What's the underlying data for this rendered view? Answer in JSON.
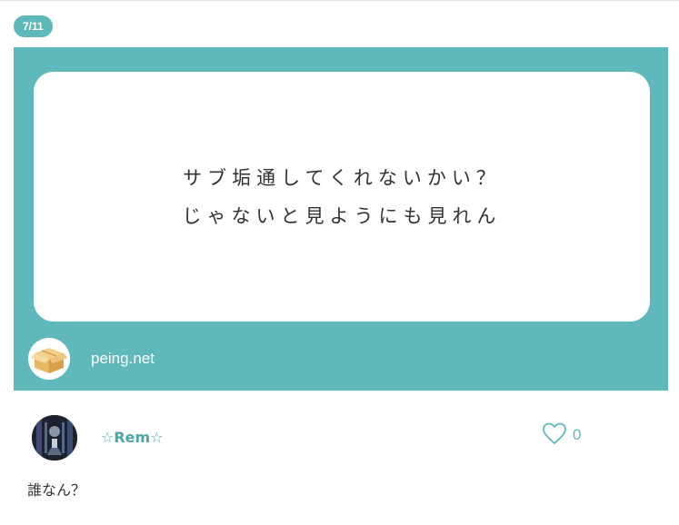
{
  "counter": {
    "label": "7/11"
  },
  "question": {
    "lines": [
      "サブ垢通してくれないかい？",
      "じゃないと見ようにも見れん"
    ]
  },
  "source": {
    "site": "peing.net",
    "icon": "cardboard-box-icon"
  },
  "answer": {
    "user_name": "☆Rem☆",
    "like_count": "0",
    "like_icon": "heart-outline-icon",
    "text": "誰なん？"
  },
  "colors": {
    "accent": "#5fb8b9",
    "username": "#4aa8a9",
    "text": "#333333"
  }
}
